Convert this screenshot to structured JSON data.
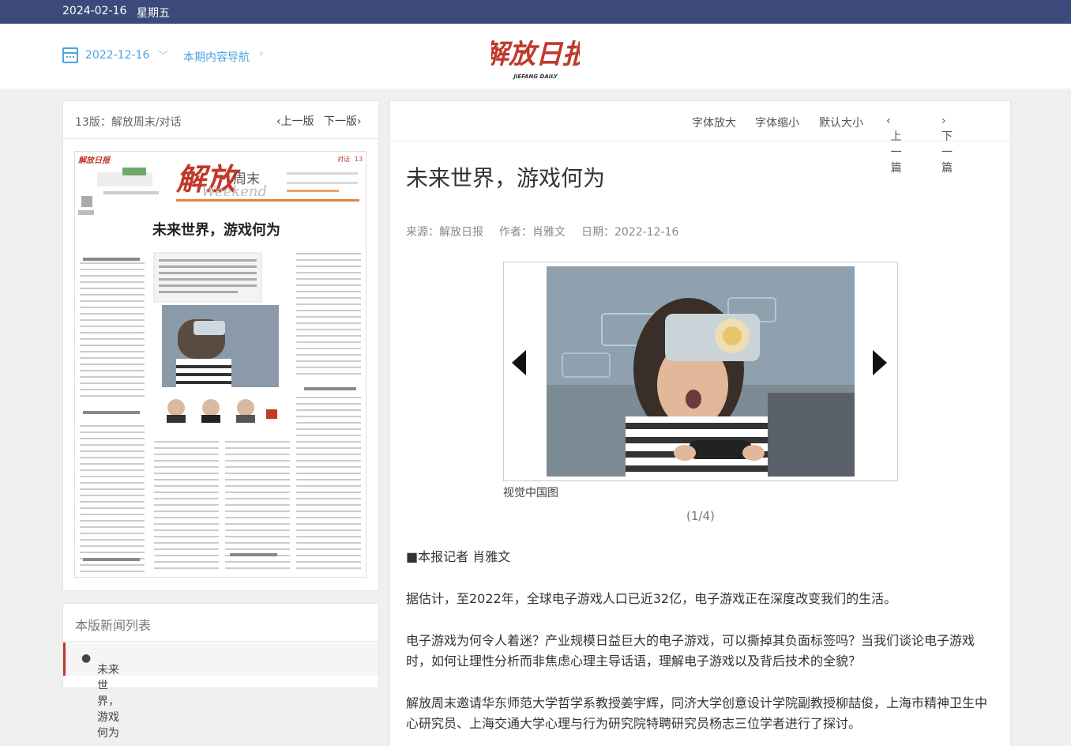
{
  "topbar": {
    "date": "2024-02-16",
    "weekday": "星期五"
  },
  "header": {
    "issue_date": "2022-12-16",
    "issue_nav": "本期内容导航",
    "logo_cn": "解放日报",
    "logo_en": "JIEFANG DAILY"
  },
  "page_panel": {
    "title": "13版：解放周末/对话",
    "prev_label": "上一版",
    "next_label": "下一版",
    "page_thumb": {
      "masthead": "解放",
      "supplement": "周末",
      "supplement_en": "Weekend",
      "section": "对话",
      "page_no": "13",
      "headline": "未来世界，游戏何为"
    }
  },
  "news_list": {
    "heading": "本版新闻列表",
    "items": [
      "未来世界，游戏何为"
    ]
  },
  "article": {
    "toolbar": {
      "enlarge": "字体放大",
      "shrink": "字体缩小",
      "default": "默认大小",
      "prev": "上一篇",
      "next": "下一篇"
    },
    "title": "未来世界，游戏何为",
    "source": "来源：解放日报",
    "author": "作者：肖雅文",
    "date": "日期：2022-12-16",
    "gallery": {
      "caption": "视觉中国图",
      "counter": "(1/4)"
    },
    "paragraphs": [
      "■本报记者 肖雅文",
      "据估计，至2022年，全球电子游戏人口已近32亿，电子游戏正在深度改变我们的生活。",
      "电子游戏为何令人着迷？产业规模日益巨大的电子游戏，可以撕掉其负面标签吗？当我们谈论电子游戏时，如何让理性分析而非焦虑心理主导话语，理解电子游戏以及背后技术的全貌？",
      "解放周末邀请华东师范大学哲学系教授姜宇辉，同济大学创意设计学院副教授柳喆俊，上海市精神卫生中心研究员、上海交通大学心理与行为研究院特聘研究员杨志三位学者进行了探讨。"
    ]
  },
  "colors": {
    "topbar": "#3b4a7a",
    "link_blue": "#4aa3df",
    "logo_red": "#c0392b",
    "accent_red": "#c0392b"
  }
}
